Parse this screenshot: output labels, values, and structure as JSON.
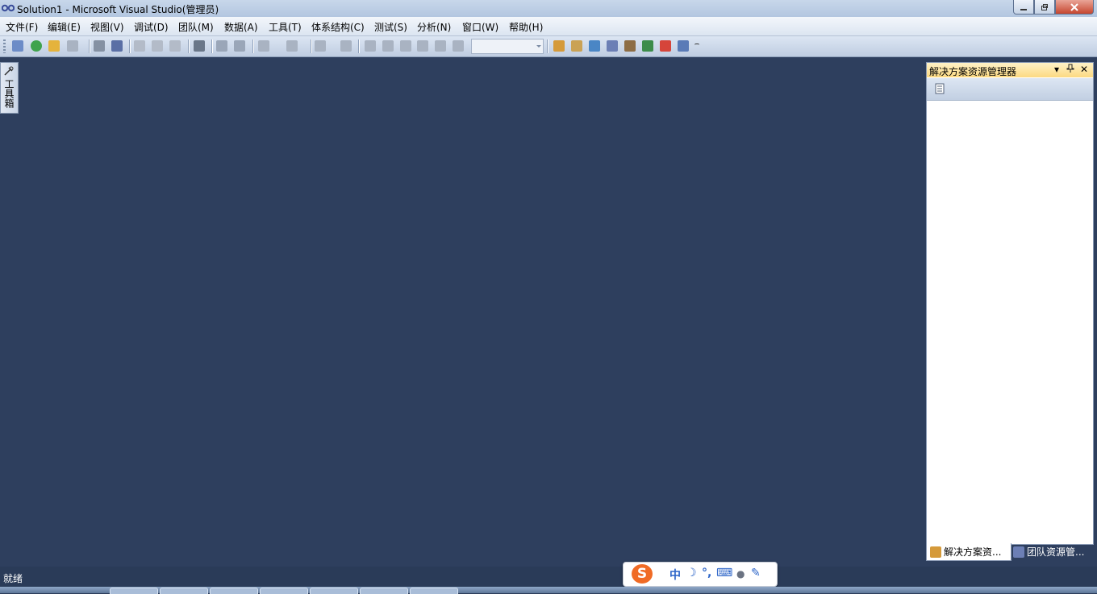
{
  "window": {
    "title": "Solution1 - Microsoft Visual Studio(管理员)",
    "controls": {
      "minimize": "minimize-icon",
      "maximize": "restore-icon",
      "close": "close-icon"
    }
  },
  "menu": [
    "文件(F)",
    "编辑(E)",
    "视图(V)",
    "调试(D)",
    "团队(M)",
    "数据(A)",
    "工具(T)",
    "体系结构(C)",
    "测试(S)",
    "分析(N)",
    "窗口(W)",
    "帮助(H)"
  ],
  "toolbar": {
    "combo_value": "",
    "icons": [
      "new-project-icon",
      "add-item-icon",
      "open-icon",
      "layout-icon",
      "save-icon",
      "save-all-icon",
      "cut-icon",
      "copy-icon",
      "paste-icon",
      "find-icon",
      "comment-icon",
      "uncomment-icon",
      "undo-icon",
      "redo-icon",
      "navigate-back-icon",
      "navigate-forward-icon",
      "start-debug-icon",
      "pause-icon",
      "stop-icon",
      "step-into-icon",
      "step-over-icon",
      "step-out-icon",
      "solution-explorer-icon",
      "properties-icon",
      "object-browser-icon",
      "team-explorer-icon",
      "toolbox-icon",
      "extension-manager-icon",
      "error-list-icon",
      "start-page-icon"
    ]
  },
  "toolbox": {
    "label": "工具箱"
  },
  "solution_explorer": {
    "title": "解决方案资源管理器",
    "pin_glyph": "ꟷ",
    "close_glyph": "✕",
    "dropdown_glyph": "▾"
  },
  "bottom_tabs": [
    {
      "label": "解决方案资...",
      "icon": "solution-explorer-icon"
    },
    {
      "label": "团队资源管...",
      "icon": "team-explorer-icon"
    }
  ],
  "status": {
    "text": "就绪"
  },
  "ime": {
    "logo": "S",
    "mode": "中",
    "moon": "☽",
    "punct": "°,",
    "keyboard": "⌨",
    "user": "●",
    "tool": "✎"
  },
  "colors": {
    "workspace": "#2e3f5e",
    "panel_header": "#fcd982",
    "ime_accent": "#f06b25"
  }
}
